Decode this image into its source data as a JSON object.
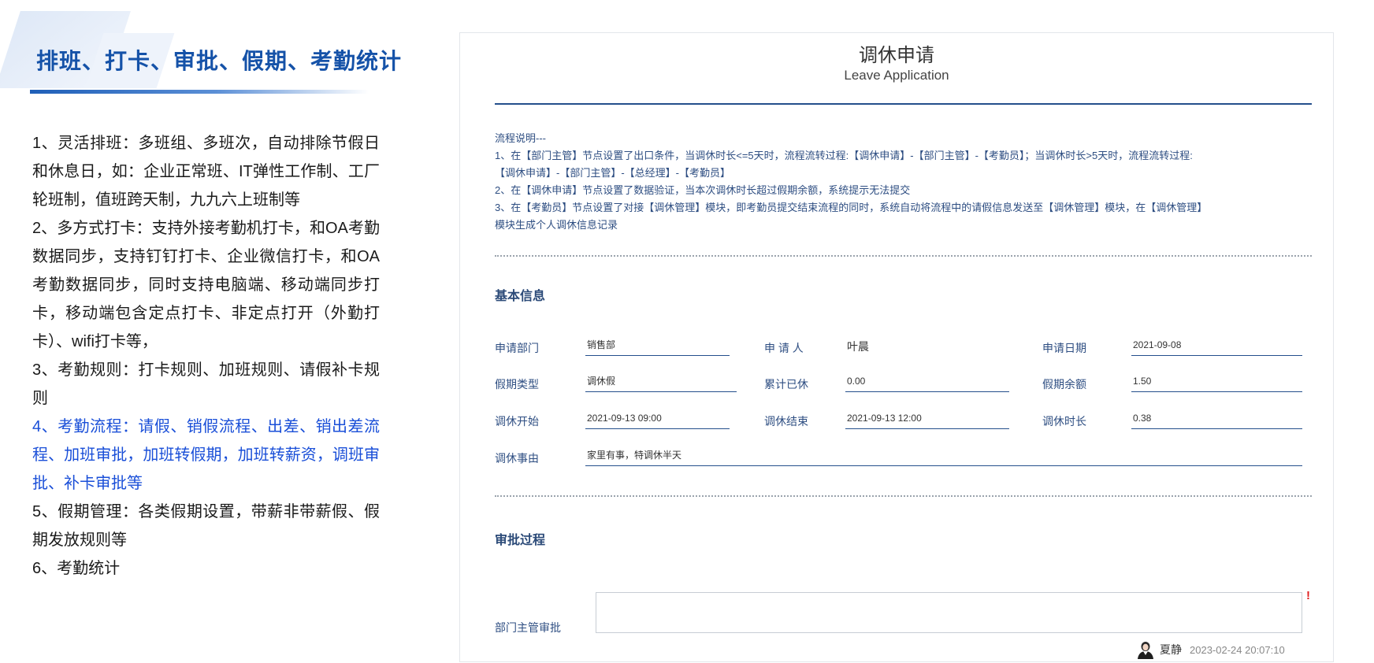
{
  "left": {
    "title": "排班、打卡、审批、假期、考勤统计",
    "items": [
      "1、灵活排班：多班组、多班次，自动排除节假日和休息日，如：企业正常班、IT弹性工作制、工厂轮班制，值班跨天制，九九六上班制等",
      "2、多方式打卡：支持外接考勤机打卡，和OA考勤数据同步，支持钉钉打卡、企业微信打卡，和OA考勤数据同步，同时支持电脑端、移动端同步打卡，移动端包含定点打卡、非定点打开（外勤打卡）、wifi打卡等，",
      "3、考勤规则：打卡规则、加班规则、请假补卡规则",
      "4、考勤流程：请假、销假流程、出差、销出差流程、加班审批，加班转假期，加班转薪资，调班审批、补卡审批等",
      "5、假期管理：各类假期设置，带薪非带薪假、假期发放规则等",
      "6、考勤统计"
    ],
    "highlight_color": "#1a4fd8"
  },
  "form": {
    "title": "调休申请",
    "subtitle": "Leave Application",
    "notes": [
      "流程说明---",
      "1、在【部门主管】节点设置了出口条件，当调休时长<=5天时，流程流转过程:【调休申请】-【部门主管】-【考勤员】；当调休时长>5天时，流程流转过程:",
      "【调休申请】-【部门主管】-【总经理】-【考勤员】",
      "2、在【调休申请】节点设置了数据验证，当本次调休时长超过假期余额，系统提示无法提交",
      "3、在【考勤员】节点设置了对接【调休管理】模块，即考勤员提交结束流程的同时，系统自动将流程中的请假信息发送至【调休管理】模块，在【调休管理】",
      "模块生成个人调休信息记录"
    ],
    "basic_section": "基本信息",
    "fields": {
      "dept_label": "申请部门",
      "dept_value": "销售部",
      "applicant_label": "申 请 人",
      "applicant_value": "叶晨",
      "date_label": "申请日期",
      "date_value": "2021-09-08",
      "type_label": "假期类型",
      "type_value": "调休假",
      "used_label": "累计已休",
      "used_value": "0.00",
      "balance_label": "假期余额",
      "balance_value": "1.50",
      "start_label": "调休开始",
      "start_value": "2021-09-13 09:00",
      "end_label": "调休结束",
      "end_value": "2021-09-13 12:00",
      "duration_label": "调休时长",
      "duration_value": "0.38",
      "reason_label": "调休事由",
      "reason_value": "家里有事，特调休半天"
    },
    "approval_section": "审批过程",
    "approval": {
      "label": "部门主管审批",
      "required_mark": "!",
      "signer": "夏静",
      "time": "2023-02-24 20:07:10"
    }
  },
  "colors": {
    "brand_blue": "#1552a8",
    "form_line": "#244f8c",
    "label_blue": "#2e4e82"
  }
}
